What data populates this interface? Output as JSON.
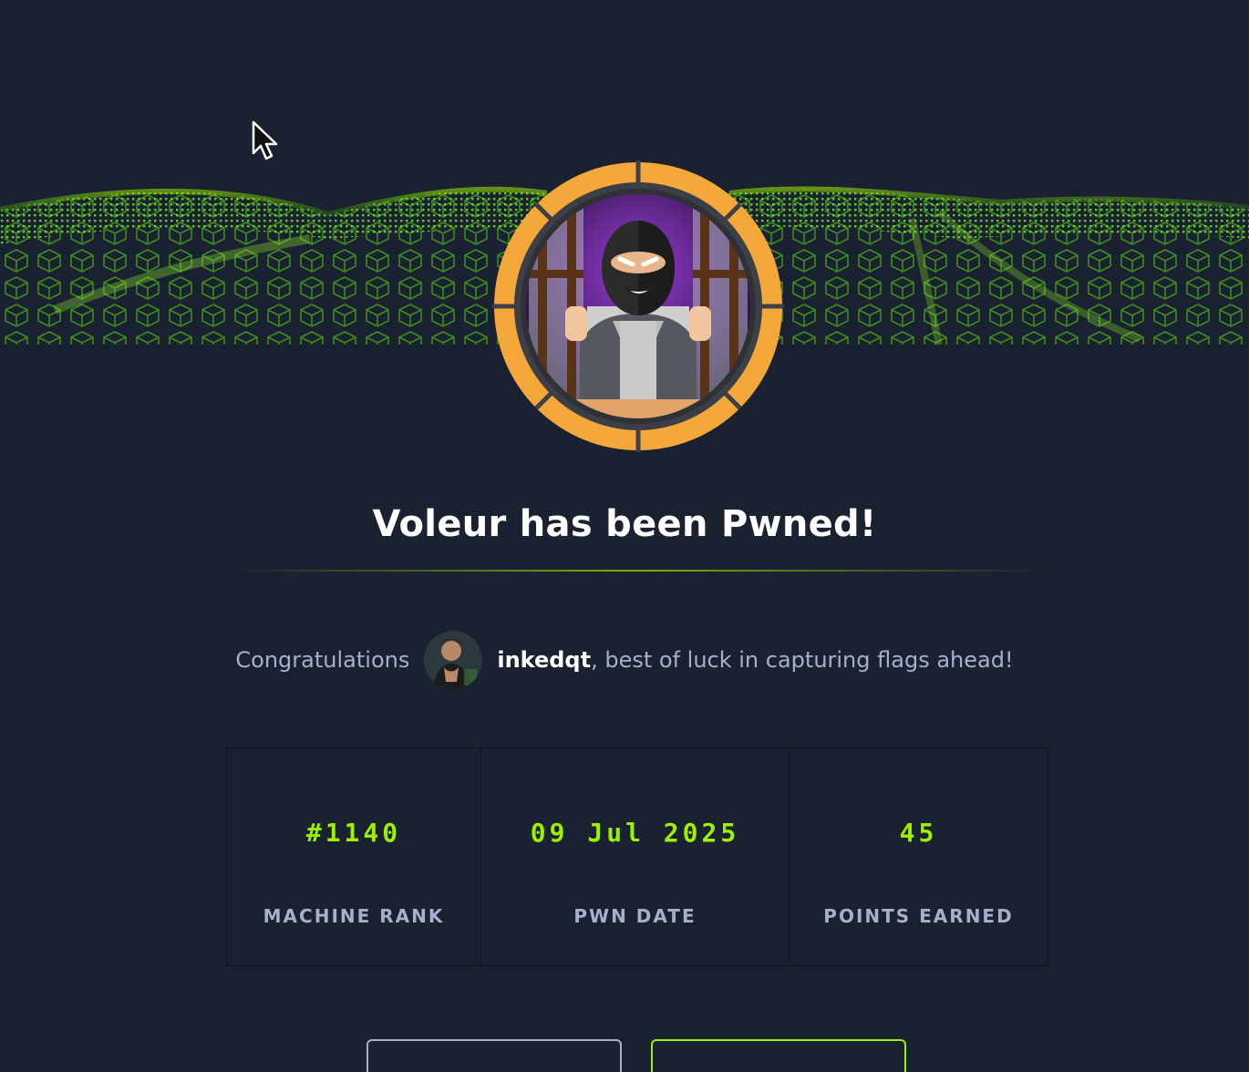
{
  "page": {
    "title": "Voleur has been Pwned!",
    "congrats_prefix": "Congratulations",
    "username": "inkedqt",
    "congrats_suffix": ", best of luck in capturing flags ahead!"
  },
  "stats": [
    {
      "value": "#1140",
      "label": "MACHINE RANK"
    },
    {
      "value": "09 Jul 2025",
      "label": "PWN DATE"
    },
    {
      "value": "45",
      "label": "POINTS EARNED"
    }
  ],
  "colors": {
    "background": "#1a2130",
    "accent_green": "#9fef00",
    "muted_text": "#a4b1cd",
    "badge_orange": "#f5a83a"
  },
  "icons": {
    "machine_badge": "thief-behind-bars-icon",
    "user_avatar": "user-avatar-icon",
    "cursor": "mouse-pointer-icon"
  }
}
